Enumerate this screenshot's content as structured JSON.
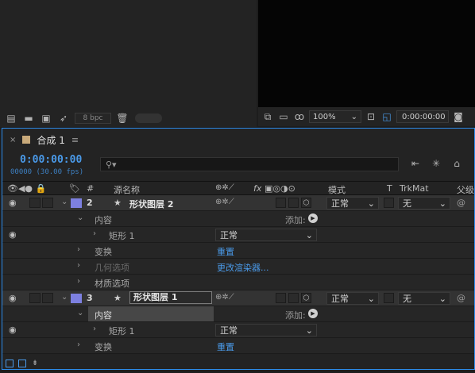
{
  "project": {
    "toolbar": {
      "bpc": "8 bpc",
      "icons": [
        "interpret-footage-icon",
        "folder-icon",
        "new-composition-icon",
        "dependency-icon",
        "trash-icon"
      ]
    }
  },
  "viewer": {
    "zoom": "100%",
    "timecode": "0:00:00:00"
  },
  "timeline": {
    "tab": {
      "label": "合成 1"
    },
    "timecode": "0:00:00:00",
    "fps": "00000 (30.00 fps)",
    "search_placeholder": "",
    "header": {
      "hash": "#",
      "source_name": "源名称",
      "fx": "fx",
      "mode": "模式",
      "t": "T",
      "trkmat": "TrkMat",
      "parent": "父级"
    },
    "rows": {
      "layer2": {
        "num": "2",
        "name": "形状图层 2",
        "mode": "正常",
        "trk": "无"
      },
      "content2": {
        "label": "内容",
        "add": "添加:"
      },
      "rect2": {
        "label": "矩形 1",
        "mode": "正常"
      },
      "transform2": {
        "label": "变换",
        "action": "重置"
      },
      "geometry2": {
        "label": "几何选项",
        "action": "更改渲染器..."
      },
      "material2": {
        "label": "材质选项"
      },
      "layer3": {
        "num": "3",
        "name": "形状图层 1",
        "mode": "正常",
        "trk": "无"
      },
      "content3": {
        "label": "内容",
        "add": "添加:"
      },
      "rect3": {
        "label": "矩形 1",
        "mode": "正常"
      },
      "transform3": {
        "label": "变换",
        "action": "重置"
      }
    }
  },
  "colors": {
    "accent": "#2d8ceb",
    "label_color": "#7d80e0",
    "comp_swatch": "#c8a97a"
  }
}
